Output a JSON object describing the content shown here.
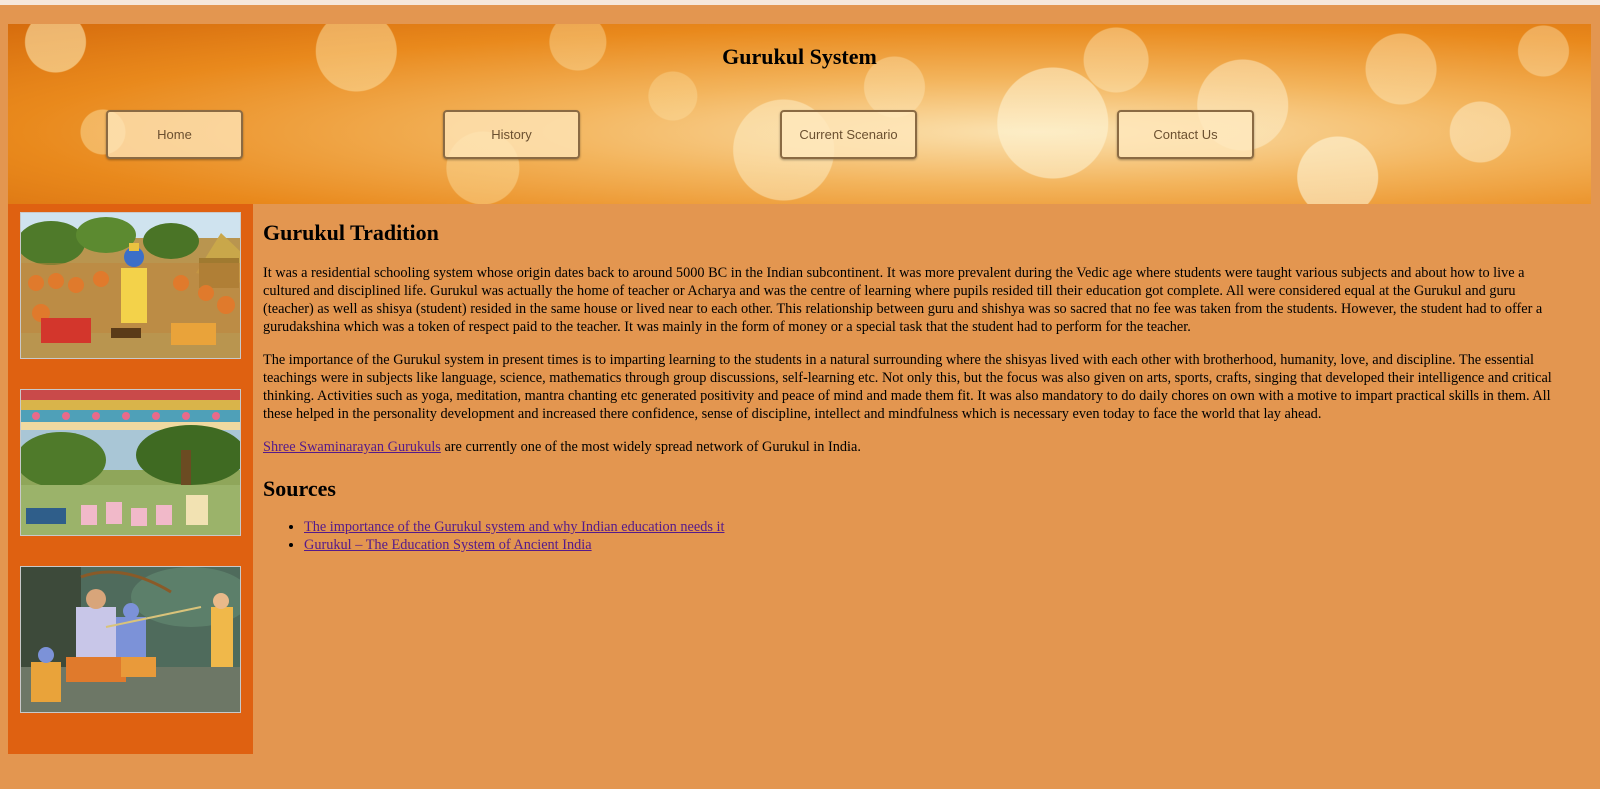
{
  "header": {
    "title": "Gurukul System",
    "nav": [
      {
        "label": "Home"
      },
      {
        "label": "History"
      },
      {
        "label": "Current Scenario"
      },
      {
        "label": "Contact Us"
      }
    ]
  },
  "sidebar": {
    "images": [
      {
        "name": "guru-teaching-disciples-image"
      },
      {
        "name": "ashram-forest-painting-image"
      },
      {
        "name": "archery-lesson-painting-image"
      }
    ]
  },
  "main": {
    "heading": "Gurukul Tradition",
    "paragraph1": "It was a residential schooling system whose origin dates back to around 5000 BC in the Indian subcontinent. It was more prevalent during the Vedic age where students were taught various subjects and about how to live a cultured and disciplined life. Gurukul was actually the home of teacher or Acharya and was the centre of learning where pupils resided till their education got complete. All were considered equal at the Gurukul and guru (teacher) as well as shisya (student) resided in the same house or lived near to each other. This relationship between guru and shishya was so sacred that no fee was taken from the students. However, the student had to offer a gurudakshina which was a token of respect paid to the teacher. It was mainly in the form of money or a special task that the student had to perform for the teacher.",
    "paragraph2": "The importance of the Gurukul system in present times is to imparting learning to the students in a natural surrounding where the shisyas lived with each other with brotherhood, humanity, love, and discipline. The essential teachings were in subjects like language, science, mathematics through group discussions, self-learning etc. Not only this, but the focus was also given on arts, sports, crafts, singing that developed their intelligence and critical thinking. Activities such as yoga, meditation, mantra chanting etc generated positivity and peace of mind and made them fit. It was also mandatory to do daily chores on own with a motive to impart practical skills in them. All these helped in the personality development and increased there confidence, sense of discipline, intellect and mindfulness which is necessary even today to face the world that lay ahead.",
    "paragraph3": {
      "link_text": "Shree Swaminarayan Gurukuls",
      "rest": " are currently one of the most widely spread network of Gurukul in India."
    },
    "sources_heading": "Sources",
    "sources": [
      {
        "text": "The importance of the Gurukul system and why Indian education needs it"
      },
      {
        "text": "Gurukul – The Education System of Ancient India"
      }
    ]
  },
  "colors": {
    "page_background": "#e39650",
    "sidebar_background": "#df6111",
    "visited_link": "#551a8b"
  }
}
